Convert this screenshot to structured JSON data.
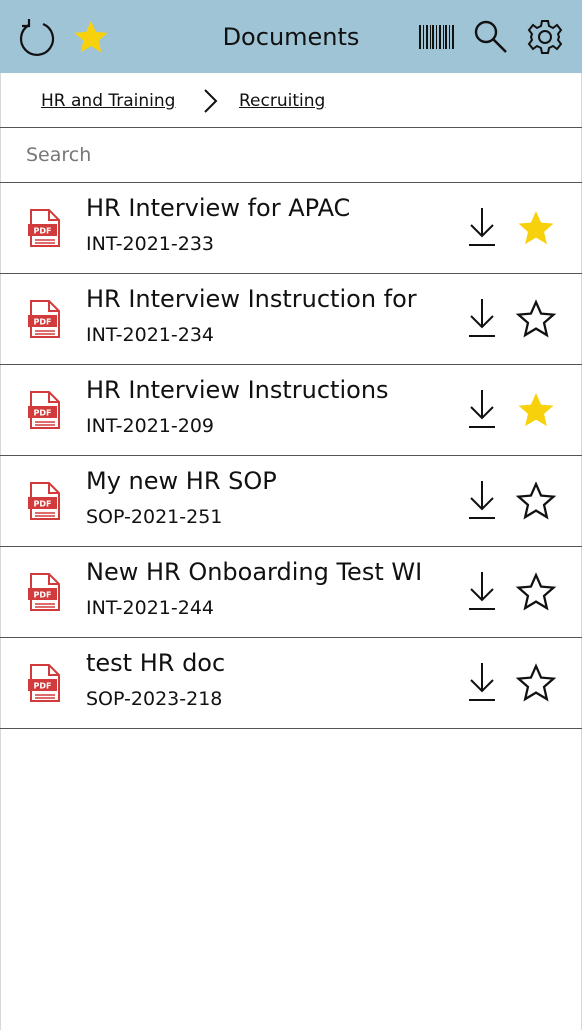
{
  "header": {
    "title": "Documents",
    "icons": [
      "refresh-icon",
      "favorites-star-icon",
      "barcode-icon",
      "search-icon",
      "gear-icon"
    ],
    "accent_color": "#9fc4d6",
    "star_color": "#f7d20c"
  },
  "breadcrumb": {
    "items": [
      {
        "label": "HR and Training"
      },
      {
        "label": "Recruiting"
      }
    ]
  },
  "search": {
    "placeholder": "Search",
    "value": ""
  },
  "documents": [
    {
      "name": "HR Interview for APAC",
      "code": "INT-2021-233",
      "favorite": true
    },
    {
      "name": "HR Interview Instruction for",
      "code": "INT-2021-234",
      "favorite": false
    },
    {
      "name": "HR Interview Instructions",
      "code": "INT-2021-209",
      "favorite": true
    },
    {
      "name": "My new HR SOP",
      "code": "SOP-2021-251",
      "favorite": false
    },
    {
      "name": "New HR Onboarding Test WI",
      "code": "INT-2021-244",
      "favorite": false
    },
    {
      "name": "test HR doc",
      "code": "SOP-2023-218",
      "favorite": false
    }
  ]
}
